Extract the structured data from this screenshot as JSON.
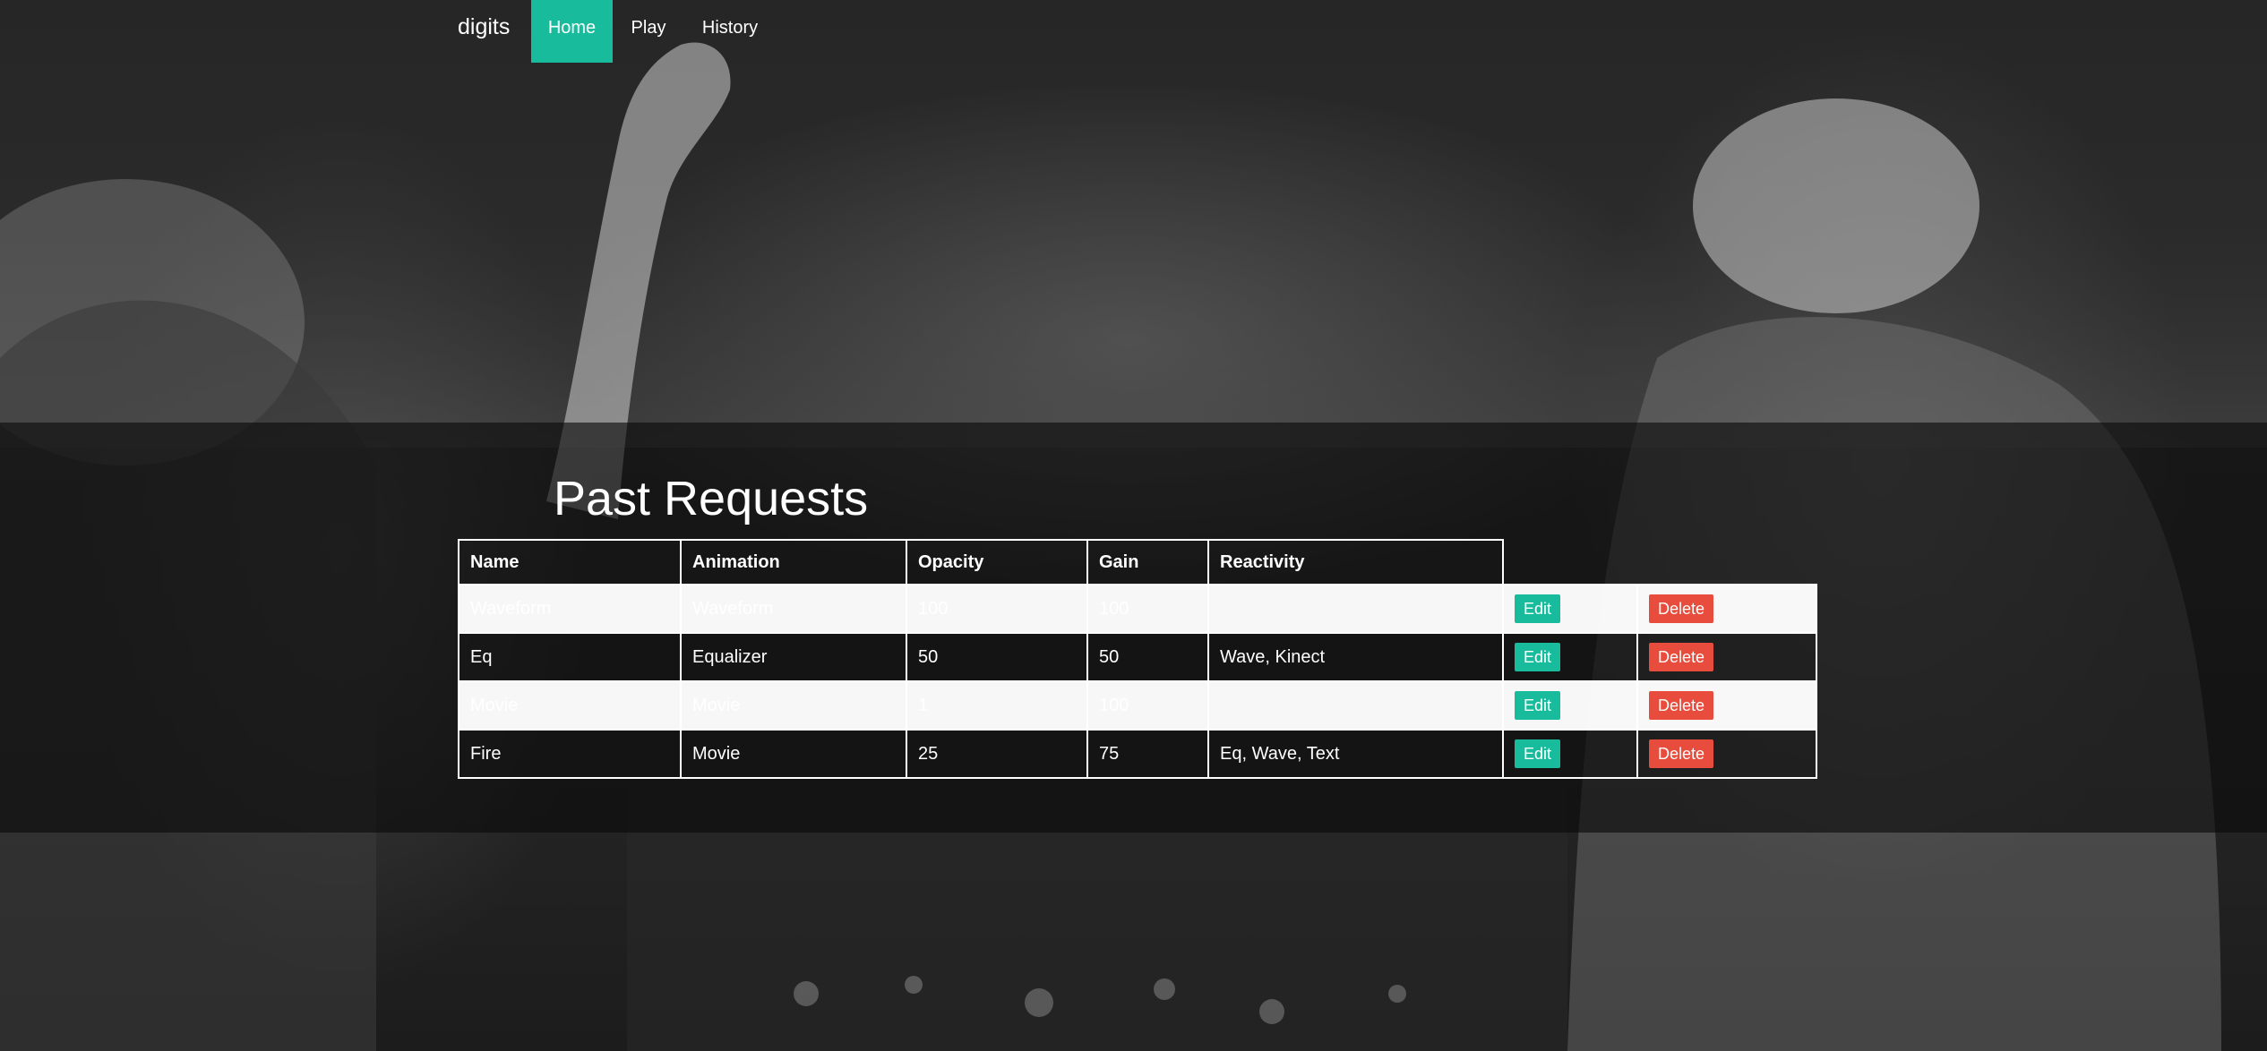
{
  "navbar": {
    "brand": "digits",
    "links": [
      {
        "label": "Home",
        "active": true
      },
      {
        "label": "Play",
        "active": false
      },
      {
        "label": "History",
        "active": false
      }
    ]
  },
  "page": {
    "title": "Past Requests"
  },
  "table": {
    "headers": [
      "Name",
      "Animation",
      "Opacity",
      "Gain",
      "Reactivity"
    ],
    "edit_label": "Edit",
    "delete_label": "Delete",
    "rows": [
      {
        "name": "Waveform",
        "animation": "Waveform",
        "opacity": "100",
        "gain": "100",
        "reactivity": ""
      },
      {
        "name": "Eq",
        "animation": "Equalizer",
        "opacity": "50",
        "gain": "50",
        "reactivity": "Wave, Kinect"
      },
      {
        "name": "Movie",
        "animation": "Movie",
        "opacity": "1",
        "gain": "100",
        "reactivity": ""
      },
      {
        "name": "Fire",
        "animation": "Movie",
        "opacity": "25",
        "gain": "75",
        "reactivity": "Eq, Wave, Text"
      }
    ]
  },
  "colors": {
    "accent": "#18bc9c",
    "danger": "#e74c3c"
  }
}
